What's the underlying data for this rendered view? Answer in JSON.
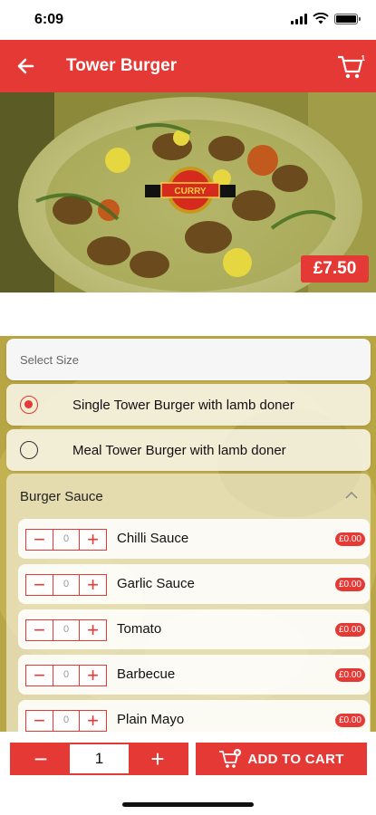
{
  "status_bar": {
    "time": "6:09"
  },
  "header": {
    "title": "Tower Burger",
    "cart_count": "1"
  },
  "hero": {
    "price": "£7.50",
    "logo_text": "CURRY"
  },
  "size_section": {
    "title": "Select Size",
    "options": [
      {
        "label": "Single Tower Burger with lamb doner",
        "selected": true
      },
      {
        "label": "Meal Tower Burger with lamb doner",
        "selected": false
      }
    ]
  },
  "sauce_section": {
    "title": "Burger Sauce",
    "items": [
      {
        "name": "Chilli Sauce",
        "qty": "0",
        "price": "£0.00"
      },
      {
        "name": "Garlic Sauce",
        "qty": "0",
        "price": "£0.00"
      },
      {
        "name": "Tomato",
        "qty": "0",
        "price": "£0.00"
      },
      {
        "name": "Barbecue",
        "qty": "0",
        "price": "£0.00"
      },
      {
        "name": "Plain Mayo",
        "qty": "0",
        "price": "£0.00"
      }
    ]
  },
  "bottom_bar": {
    "quantity": "1",
    "add_to_cart_label": "ADD TO CART"
  },
  "colors": {
    "accent": "#e53935"
  }
}
